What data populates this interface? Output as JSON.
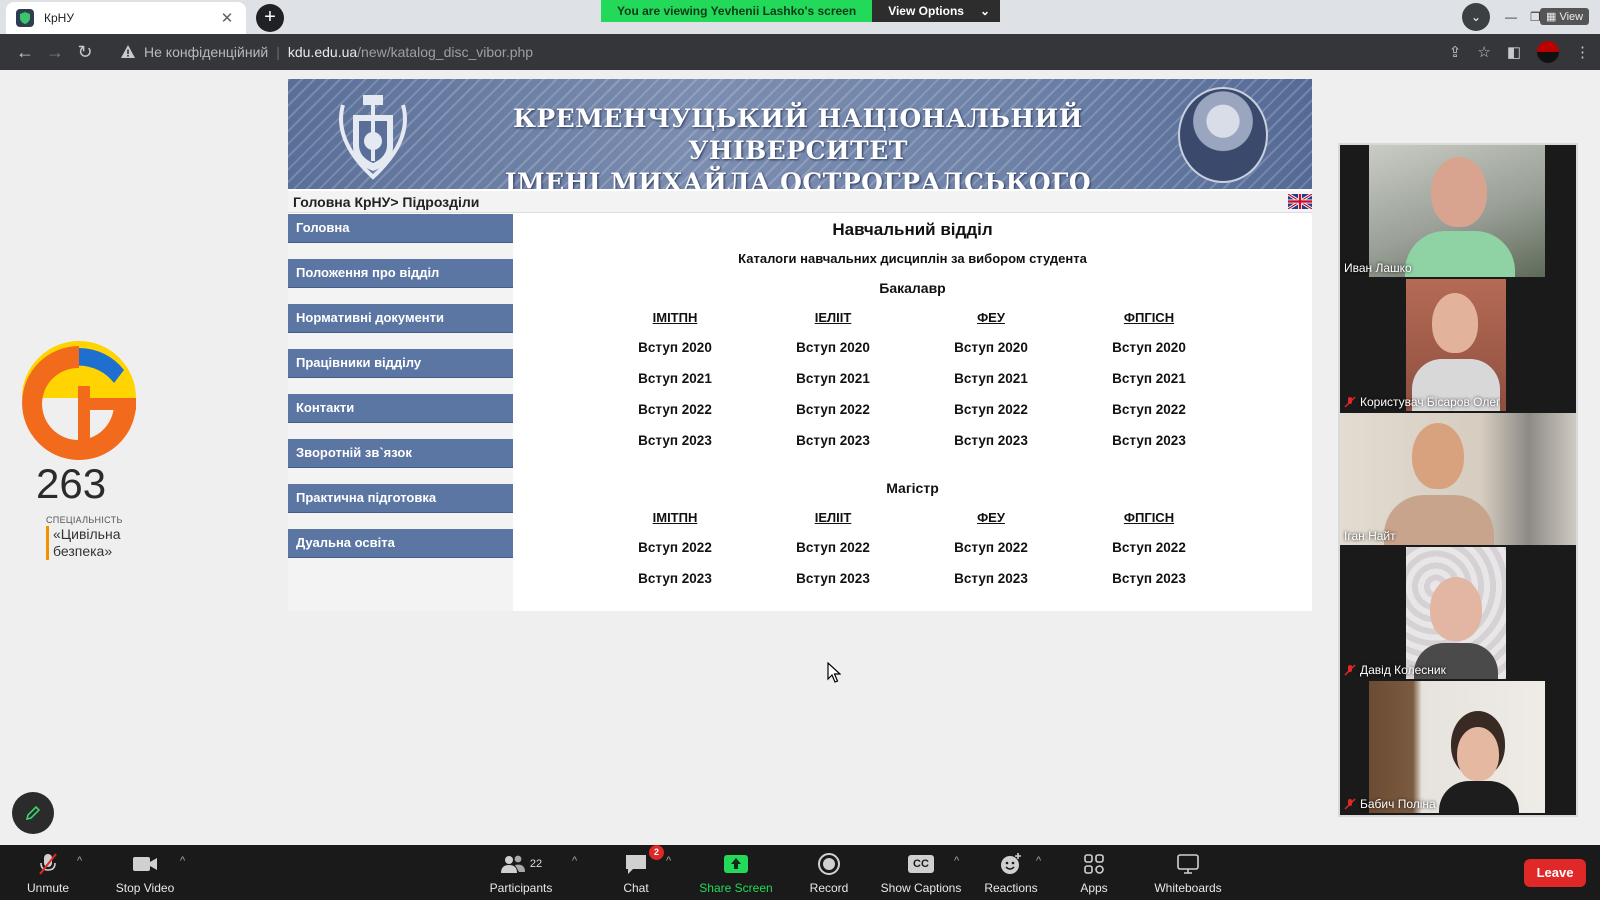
{
  "browser": {
    "tab_title": "КрНУ",
    "new_tab": "+",
    "insecure_label": "Не конфіденційний",
    "url_host": "kdu.edu.ua",
    "url_path": "/new/katalog_disc_vibor.php"
  },
  "share_banner": {
    "text": "You are viewing Yevhenii Lashko's screen",
    "options": "View Options"
  },
  "view_badge": "View",
  "spec_logo": {
    "number": "263",
    "small": "СПЕЦІАЛЬНІСТЬ",
    "name_line1": "«Цивільна",
    "name_line2": "безпека»"
  },
  "site": {
    "title_line1": "КРЕМЕНЧУЦЬКИЙ НАЦІОНАЛЬНИЙ УНІВЕРСИТЕТ",
    "title_line2": "ІМЕНІ МИХАЙЛА ОСТРОГРАДСЬКОГО",
    "breadcrumb": "Головна КрНУ> Підрозділи",
    "menu": [
      "Головна",
      "Положення про відділ",
      "Нормативні документи",
      "Працівники відділу",
      "Контакти",
      "Зворотній зв`язок",
      "Практична підготовка",
      "Дуальна освіта"
    ],
    "dept_title": "Навчальний відділ",
    "subtitle": "Каталоги навчальних дисциплін за вибором студента",
    "bachelor": {
      "label": "Бакалавр",
      "columns": [
        {
          "head": "ІМІТПН",
          "rows": [
            "Вступ 2020",
            "Вступ 2021",
            "Вступ 2022",
            "Вступ 2023"
          ]
        },
        {
          "head": "ІЕЛІІТ",
          "rows": [
            "Вступ 2020",
            "Вступ 2021",
            "Вступ 2022",
            "Вступ 2023"
          ]
        },
        {
          "head": "ФЕУ",
          "rows": [
            "Вступ 2020",
            "Вступ 2021",
            "Вступ 2022",
            "Вступ 2023"
          ]
        },
        {
          "head": "ФПГІСН",
          "rows": [
            "Вступ 2020",
            "Вступ 2021",
            "Вступ 2022",
            "Вступ 2023"
          ]
        }
      ]
    },
    "master": {
      "label": "Магістр",
      "columns": [
        {
          "head": "ІМІТПН",
          "rows": [
            "Вступ 2022",
            "Вступ 2023"
          ]
        },
        {
          "head": "ІЕЛІІТ",
          "rows": [
            "Вступ 2022",
            "Вступ 2023"
          ]
        },
        {
          "head": "ФЕУ",
          "rows": [
            "Вступ 2022",
            "Вступ 2023"
          ]
        },
        {
          "head": "ФПГІСН",
          "rows": [
            "Вступ 2022",
            "Вступ 2023"
          ]
        }
      ]
    }
  },
  "participants": [
    {
      "name": "Иван Лашко",
      "muted": false
    },
    {
      "name": "Користувач Бісаров Олег",
      "muted": true
    },
    {
      "name": "Іган Найт",
      "muted": false
    },
    {
      "name": "Давід Колесник",
      "muted": true
    },
    {
      "name": "Бабич Поліна",
      "muted": true
    }
  ],
  "zoom_bar": {
    "unmute": "Unmute",
    "stop_video": "Stop Video",
    "participants": "Participants",
    "participant_count": "22",
    "chat": "Chat",
    "chat_badge": "2",
    "share_screen": "Share Screen",
    "record": "Record",
    "show_captions": "Show Captions",
    "captions_icon_text": "CC",
    "reactions": "Reactions",
    "apps": "Apps",
    "whiteboards": "Whiteboards",
    "leave": "Leave"
  },
  "colors": {
    "menu_blue": "#5c76a3",
    "share_green": "#23d959",
    "leave_red": "#e02828",
    "logo_orange": "#f39200"
  }
}
